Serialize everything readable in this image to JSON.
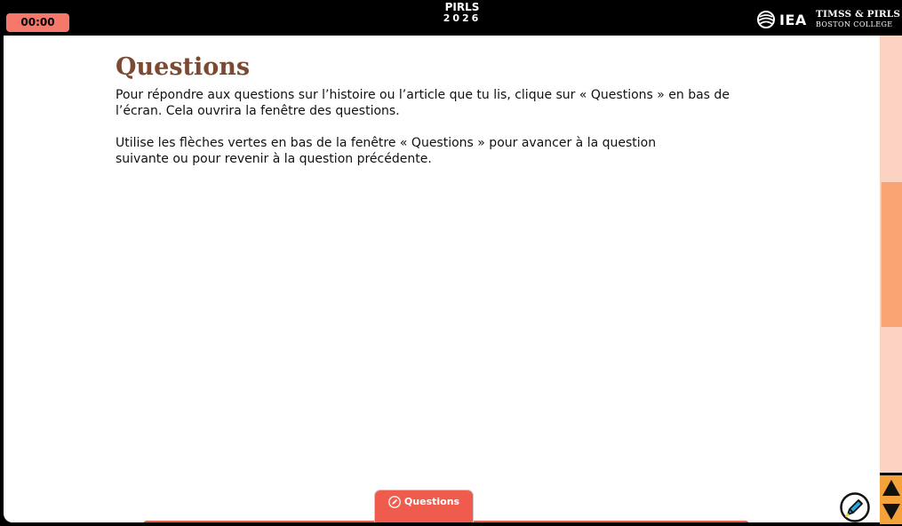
{
  "header": {
    "timer": "00:00",
    "program_name": "PIRLS",
    "program_year": "2026",
    "iea_label": "IEA",
    "partner_line1": "TIMSS & PIRLS",
    "partner_line2": "BOSTON COLLEGE"
  },
  "main": {
    "title": "Questions",
    "paragraph1": "Pour répondre aux questions sur l’histoire ou l’article que tu lis, clique sur « Questions » en bas de l’écran. Cela ouvrira la fenêtre des questions.",
    "paragraph2": "Utilise les flèches vertes en bas de la fenêtre « Questions » pour avancer à la question suivante ou pour revenir à la question précédente."
  },
  "footer": {
    "questions_tab_label": "Questions",
    "questions_tab_icon": "pencil-icon",
    "highlighter_icon": "highlighter-icon"
  },
  "colors": {
    "accent_red": "#ef5b4d",
    "timer_bg": "#f5786a",
    "title_brown": "#7a4a33",
    "scroll_track": "#fcd3c3",
    "scroll_thumb": "#f9a472",
    "nav_arrows_bg": "#f6a23a"
  }
}
